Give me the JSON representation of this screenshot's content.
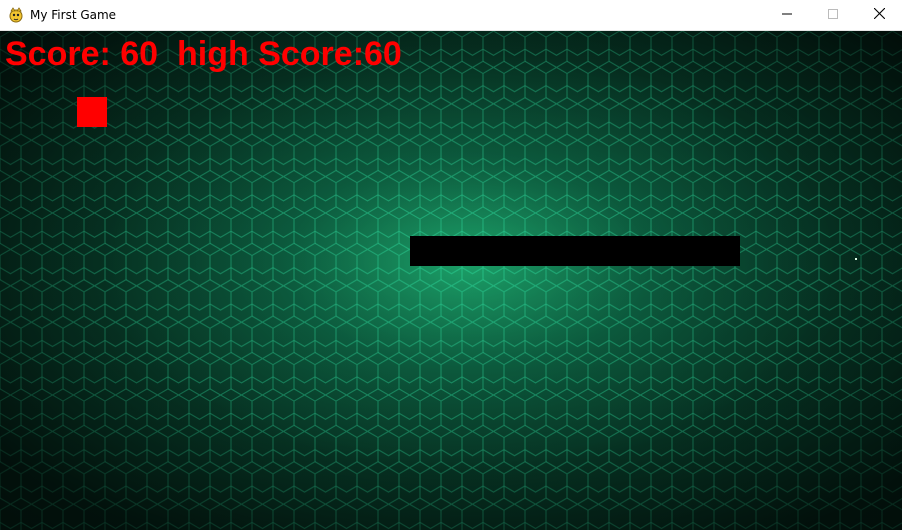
{
  "window": {
    "title": "My First Game",
    "icon": "pygame-snake-icon",
    "controls": {
      "minimize": "minimize-icon",
      "maximize": "maximize-icon",
      "close": "close-icon"
    }
  },
  "hud": {
    "score_text": "Score: 60",
    "high_score_text": "high Score:60",
    "score": 60,
    "high_score": 60
  },
  "game": {
    "food_color": "#ff0000",
    "snake_color": "#000000",
    "hud_color": "#ff0000",
    "background": "green hexagon pattern"
  }
}
